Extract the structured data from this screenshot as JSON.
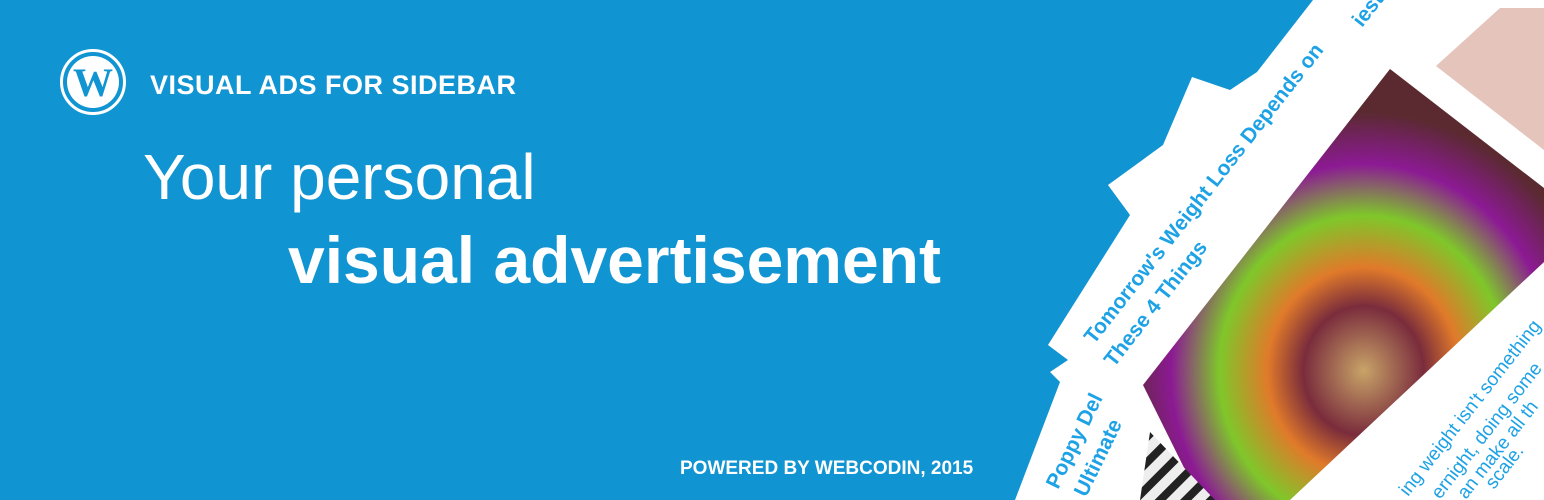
{
  "brand": {
    "logo_icon": "wordpress-icon",
    "plugin_name": "VISUAL ADS FOR SIDEBAR"
  },
  "headline": {
    "line1": "Your personal",
    "line2": "visual advertisement"
  },
  "footer": {
    "powered_by": "POWERED BY WEBCODIN, 2015"
  },
  "cards": [
    {
      "title_line1": "Tomorrow's Weight Loss Depends on",
      "title_line2": "These 4 Things",
      "excerpt": [
        "ing weight isn't something",
        "ernight, doing some",
        "an make all th",
        "scale."
      ]
    },
    {
      "title_line1": "Poppy Del",
      "title_line2": "Ultimate "
    },
    {
      "title_line1": "iest"
    }
  ],
  "colors": {
    "background": "#1194d2",
    "accent_text": "#1ea2e6"
  }
}
